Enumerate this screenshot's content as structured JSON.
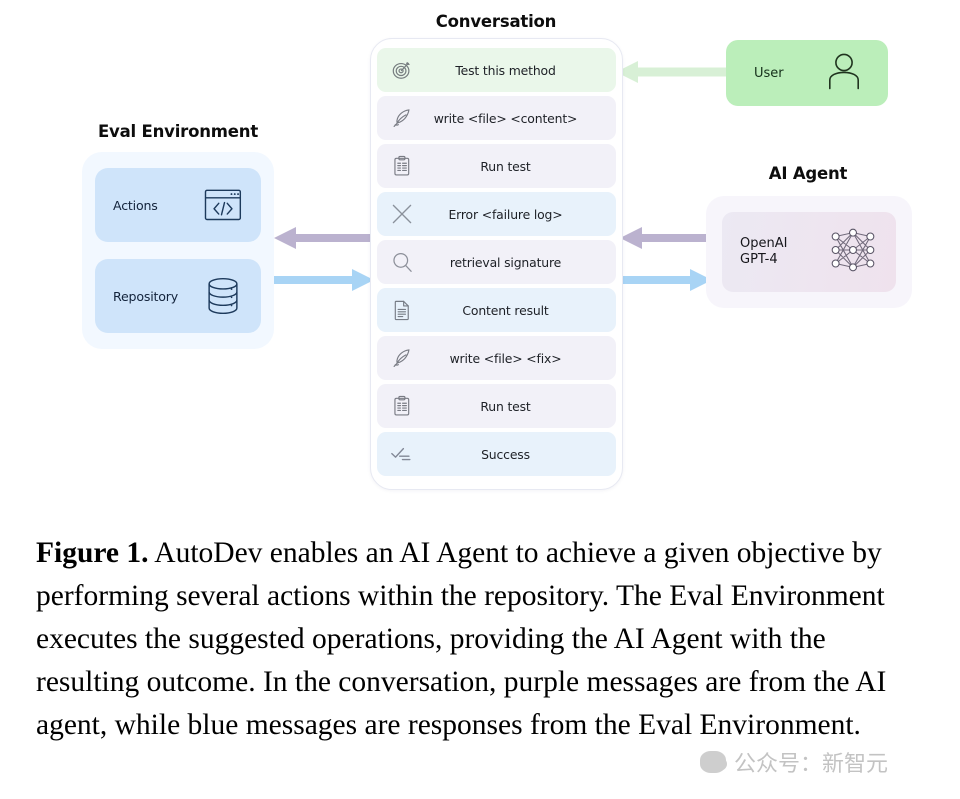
{
  "figure": {
    "sections": {
      "conversation_title": "Conversation",
      "eval_title": "Eval Environment",
      "agent_title": "AI Agent"
    },
    "conversation": {
      "messages": [
        {
          "icon": "target-icon",
          "text": "Test this method",
          "source": "user",
          "color": "#eaf7ea"
        },
        {
          "icon": "quill-icon",
          "text": "write <file> <content>",
          "source": "agent",
          "color": "#f2f1f8"
        },
        {
          "icon": "clipboard-icon",
          "text": "Run test",
          "source": "agent",
          "color": "#f2f1f8"
        },
        {
          "icon": "cross-icon",
          "text": "Error <failure log>",
          "source": "env",
          "color": "#e8f2fb"
        },
        {
          "icon": "magnifier-icon",
          "text": "retrieval signature",
          "source": "agent",
          "color": "#f2f1f8"
        },
        {
          "icon": "document-icon",
          "text": "Content result",
          "source": "env",
          "color": "#e8f2fb"
        },
        {
          "icon": "quill-icon",
          "text": "write <file> <fix>",
          "source": "agent",
          "color": "#f2f1f8"
        },
        {
          "icon": "clipboard-icon",
          "text": "Run test",
          "source": "agent",
          "color": "#f2f1f8"
        },
        {
          "icon": "checklist-icon",
          "text": "Success",
          "source": "env",
          "color": "#e8f2fb"
        }
      ]
    },
    "eval_environment": {
      "cards": [
        {
          "label": "Actions",
          "icon": "code-window-icon"
        },
        {
          "label": "Repository",
          "icon": "database-icon"
        }
      ]
    },
    "user": {
      "label": "User",
      "icon": "person-icon"
    },
    "agent": {
      "label": "OpenAI\nGPT-4",
      "icon": "neural-network-icon"
    },
    "arrows": [
      {
        "name": "user-to-conversation",
        "direction": "left",
        "color": "#d8f0d6"
      },
      {
        "name": "agent-to-conversation",
        "direction": "left",
        "color": "#bbb2cf"
      },
      {
        "name": "conversation-to-agent",
        "direction": "right",
        "color": "#a8d4f5"
      },
      {
        "name": "conversation-to-eval",
        "direction": "left",
        "color": "#bbb2cf"
      },
      {
        "name": "eval-to-conversation",
        "direction": "right",
        "color": "#a8d4f5"
      }
    ]
  },
  "caption": {
    "figure_number": "Figure 1.",
    "body": " AutoDev enables an AI Agent to achieve a given objective by performing several actions within the repository. The Eval Environment executes the suggested operations, providing the AI Agent with the resulting outcome. In the conversation, purple messages are from the AI agent, while blue messages are responses from the Eval Environment."
  },
  "watermark": {
    "text": "公众号：新智元"
  }
}
